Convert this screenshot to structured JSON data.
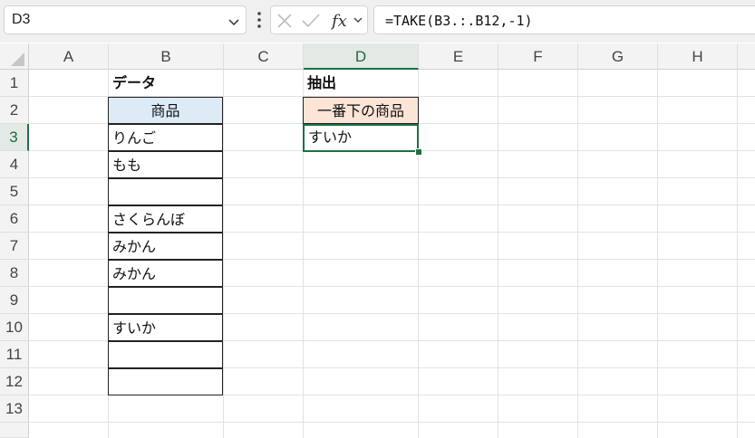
{
  "formula_bar": {
    "name_box": "D3",
    "formula": "=TAKE(B3.:.B12,-1)",
    "icons": [
      "chevron-down-icon",
      "more-icon",
      "cancel-icon",
      "enter-icon",
      "fx-icon"
    ]
  },
  "columns": [
    "A",
    "B",
    "C",
    "D",
    "E",
    "F",
    "G",
    "H"
  ],
  "rows": [
    "1",
    "2",
    "3",
    "4",
    "5",
    "6",
    "7",
    "8",
    "9",
    "10",
    "11",
    "12",
    "13"
  ],
  "selected_cell": "D3",
  "cells": {
    "B1": "データ",
    "B2": "商品",
    "B3": "りんご",
    "B4": "もも",
    "B5": "",
    "B6": "さくらんぼ",
    "B7": "みかん",
    "B8": "みかん",
    "B9": "",
    "B10": "すいか",
    "B11": "",
    "B12": "",
    "D1": "抽出",
    "D2": "一番下の商品",
    "D3": "すいか"
  },
  "colors": {
    "accent": "#1e7145",
    "header_b2_fill": "#ddebf7",
    "header_d2_fill": "#fce4d6"
  }
}
